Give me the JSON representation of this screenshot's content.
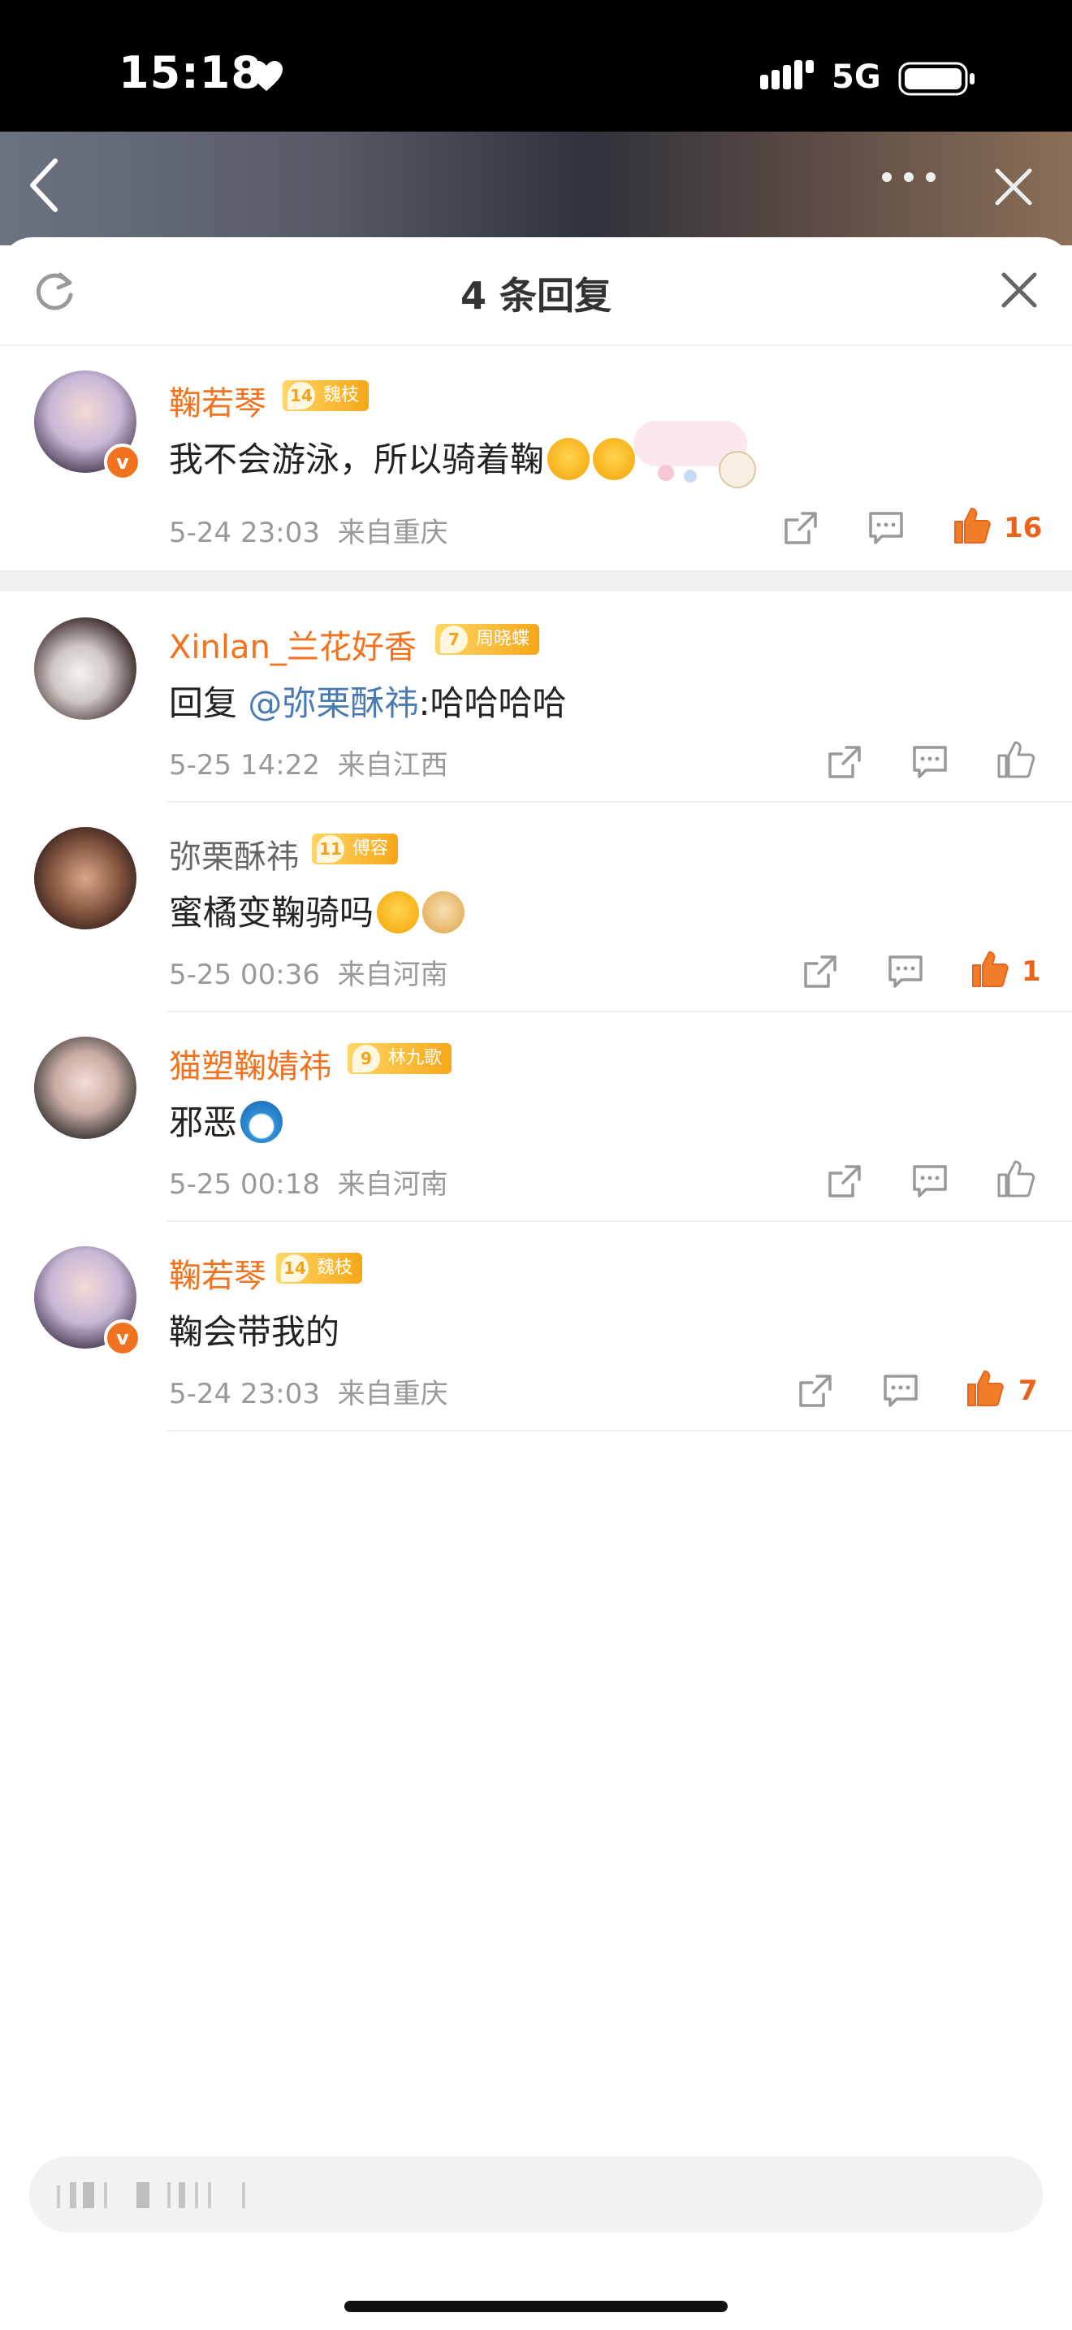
{
  "status_bar": {
    "time": "15:18",
    "network": "5G"
  },
  "sheet": {
    "title": "4 条回复"
  },
  "main_comment": {
    "username": "鞠若琴",
    "level": "14",
    "badge_name": "魏枝",
    "text": "我不会游泳，所以骑着鞠",
    "time": "5-24 23:03",
    "location": "来自重庆",
    "likes": "16"
  },
  "replies": [
    {
      "username": "Xinlan_兰花好香",
      "level": "7",
      "badge_name": "周晓蝶",
      "reply_prefix": "回复",
      "mention": "@弥栗酥祎",
      "text": ":哈哈哈哈",
      "time": "5-25 14:22",
      "location": "来自江西",
      "likes": ""
    },
    {
      "username": "弥栗酥祎",
      "level": "11",
      "badge_name": "傅容",
      "text": "蜜橘变鞠骑吗",
      "time": "5-25 00:36",
      "location": "来自河南",
      "likes": "1"
    },
    {
      "username": "猫塑鞠婧祎",
      "level": "9",
      "badge_name": "林九歌",
      "text": "邪恶",
      "time": "5-25 00:18",
      "location": "来自河南",
      "likes": ""
    },
    {
      "username": "鞠若琴",
      "level": "14",
      "badge_name": "魏枝",
      "text": "鞠会带我的",
      "time": "5-24 23:03",
      "location": "来自重庆",
      "likes": "7"
    }
  ],
  "colors": {
    "accent": "#f2731f",
    "like": "#e8641a",
    "mention": "#4a7ab3",
    "meta": "#999999"
  }
}
